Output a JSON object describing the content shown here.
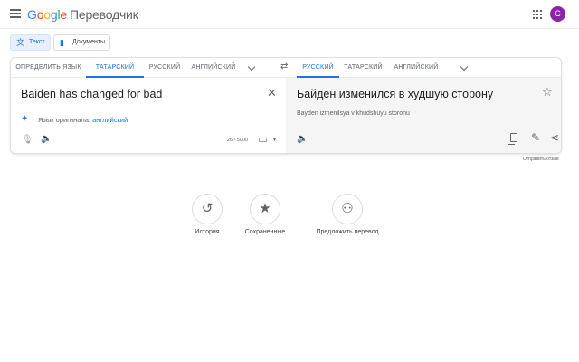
{
  "header": {
    "logo_letters": [
      "G",
      "o",
      "o",
      "g",
      "l",
      "e"
    ],
    "product_name": "Переводчик",
    "avatar_letter": "C",
    "avatar_color": "#8e24aa"
  },
  "modes": {
    "text_label": "Текст",
    "documents_label": "Документы"
  },
  "source_langs": [
    "ОПРЕДЕЛИТЬ ЯЗЫК",
    "ТАТАРСКИЙ",
    "РУССКИЙ",
    "АНГЛИЙСКИЙ"
  ],
  "source_active_index": 1,
  "target_langs": [
    "РУССКИЙ",
    "ТАТАРСКИЙ",
    "АНГЛИЙСКИЙ"
  ],
  "target_active_index": 0,
  "source": {
    "text": "Baiden has changed for bad",
    "detected_prefix": "Язык оригинала:",
    "detected_language": "английский",
    "char_count": "26 / 5000"
  },
  "target": {
    "text": "Байден изменился в худшую сторону",
    "transliteration": "Bayden izmenilsya v khudshuyu storonu"
  },
  "feedback_label": "Отправить отзыв",
  "features": {
    "history_label": "История",
    "saved_label": "Сохраненные",
    "suggest_label": "Предложить перевод"
  },
  "colors": {
    "accent": "#1a73e8",
    "target_bg": "#f5f5f5"
  }
}
